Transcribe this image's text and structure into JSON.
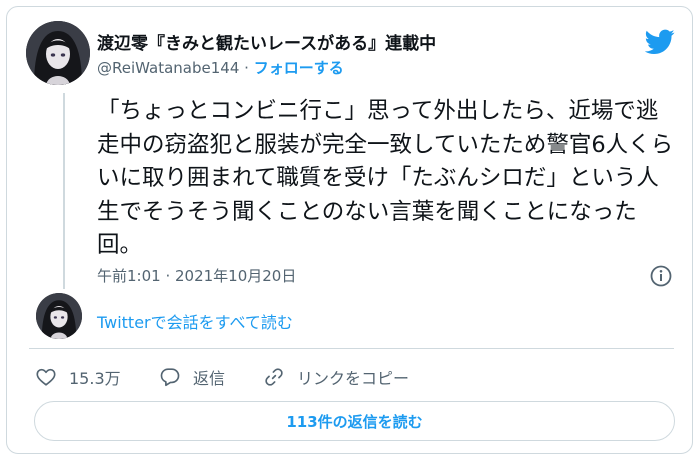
{
  "author": {
    "display_name": "渡辺零『きみと観たいレースがある』連載中",
    "handle": "@ReiWatanabe144",
    "separator": "·",
    "follow_label": "フォローする"
  },
  "tweet": {
    "text": "「ちょっとコンビニ行こ」思って外出したら、近場で逃走中の窃盗犯と服装が完全一致していたため警官6人くらいに取り囲まれて職質を受け「たぶんシロだ」という人生でそうそう聞くことのない言葉を聞くことになった回。",
    "timestamp": "午前1:01 · 2021年10月20日"
  },
  "conversation": {
    "read_label": "Twitterで会話をすべて読む"
  },
  "actions": {
    "like_count": "15.3万",
    "reply_label": "返信",
    "copy_link_label": "リンクをコピー"
  },
  "replies_button": {
    "label": "113件の返信を読む"
  },
  "colors": {
    "accent": "#1d9bf0",
    "secondary_text": "#536471",
    "border": "#cfd9de"
  },
  "icons": [
    "twitter-bird-icon",
    "info-icon",
    "heart-icon",
    "reply-bubble-icon",
    "link-icon"
  ]
}
